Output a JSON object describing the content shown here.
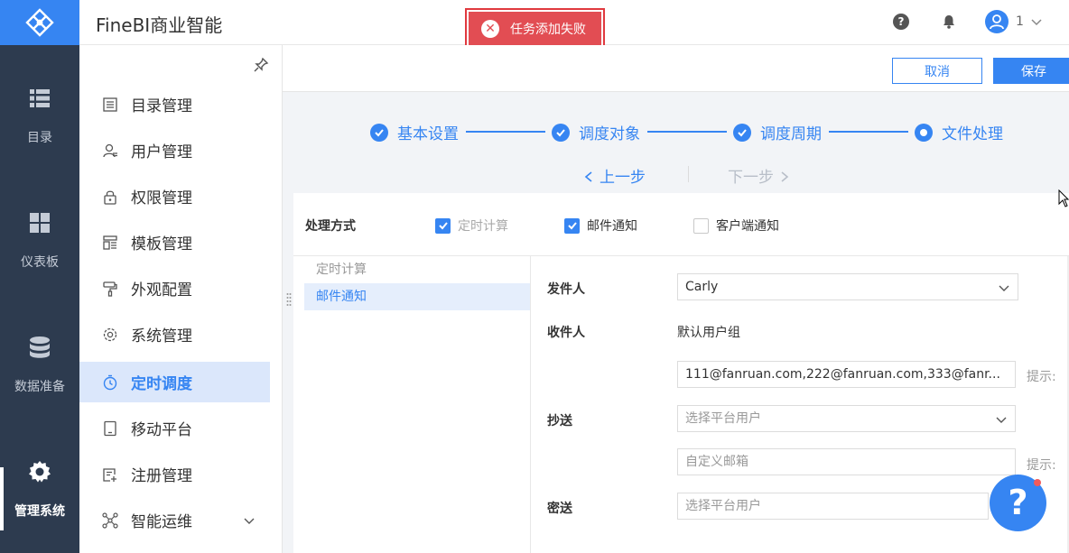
{
  "header": {
    "app_title": "FineBI商业智能",
    "user_name": "1"
  },
  "toast": {
    "message": "任务添加失败"
  },
  "rail": {
    "items": [
      {
        "label": "目录"
      },
      {
        "label": "仪表板"
      },
      {
        "label": "数据准备"
      },
      {
        "label": "管理系统",
        "active": true
      }
    ]
  },
  "menu": {
    "items": [
      {
        "label": "目录管理"
      },
      {
        "label": "用户管理"
      },
      {
        "label": "权限管理"
      },
      {
        "label": "模板管理"
      },
      {
        "label": "外观配置"
      },
      {
        "label": "系统管理"
      },
      {
        "label": "定时调度",
        "active": true
      },
      {
        "label": "移动平台"
      },
      {
        "label": "注册管理"
      },
      {
        "label": "智能运维"
      }
    ]
  },
  "actions": {
    "cancel_label": "取消",
    "save_label": "保存"
  },
  "steps": {
    "items": [
      {
        "label": "基本设置",
        "state": "done"
      },
      {
        "label": "调度对象",
        "state": "done"
      },
      {
        "label": "调度周期",
        "state": "done"
      },
      {
        "label": "文件处理",
        "state": "current"
      }
    ],
    "prev_label": "上一步",
    "next_label": "下一步"
  },
  "processing": {
    "label": "处理方式",
    "options": [
      {
        "label": "定时计算",
        "checked": true,
        "disabled": true
      },
      {
        "label": "邮件通知",
        "checked": true,
        "disabled": false
      },
      {
        "label": "客户端通知",
        "checked": false,
        "disabled": false
      }
    ],
    "list": [
      {
        "label": "定时计算"
      },
      {
        "label": "邮件通知",
        "active": true
      }
    ]
  },
  "form": {
    "sender_label": "发件人",
    "sender_value": "Carly",
    "recipient_label": "收件人",
    "recipient_default": "默认用户组",
    "recipient_emails": "111@fanruan.com,222@fanruan.com,333@fanr...",
    "hint_label": "提示:",
    "cc_label": "抄送",
    "cc_placeholder": "选择平台用户",
    "custom_email_placeholder": "自定义邮箱",
    "bcc_label": "密送",
    "bcc_placeholder": "选择平台用户"
  },
  "colors": {
    "brand": "#3685f2",
    "rail_bg": "#2d3b4f",
    "toast_bg": "#e24d53",
    "active_menu_bg": "#dbe7fb"
  }
}
